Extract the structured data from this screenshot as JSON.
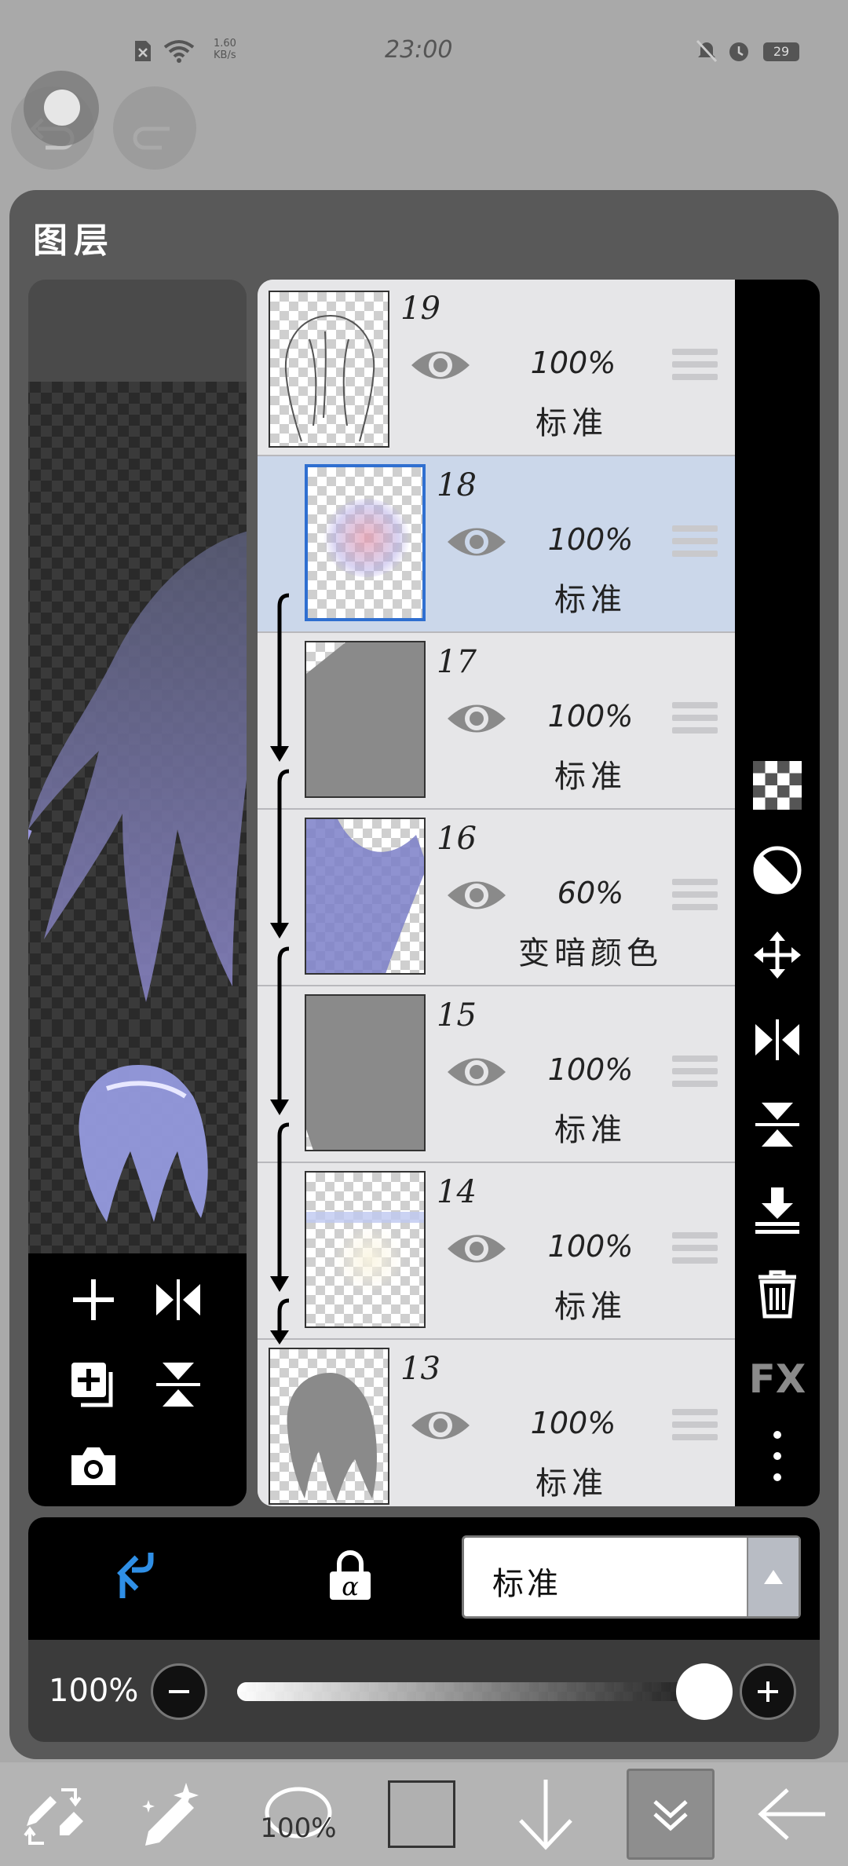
{
  "status_bar": {
    "network_speed": "1.60\nKB/s",
    "time": "23:00",
    "battery": "29"
  },
  "panel": {
    "title": "图层"
  },
  "layers": [
    {
      "number": "19",
      "opacity": "100%",
      "blend_mode": "标准",
      "selected": false
    },
    {
      "number": "18",
      "opacity": "100%",
      "blend_mode": "标准",
      "selected": true
    },
    {
      "number": "17",
      "opacity": "100%",
      "blend_mode": "标准",
      "selected": false
    },
    {
      "number": "16",
      "opacity": "60%",
      "blend_mode": "变暗颜色",
      "selected": false
    },
    {
      "number": "15",
      "opacity": "100%",
      "blend_mode": "标准",
      "selected": false
    },
    {
      "number": "14",
      "opacity": "100%",
      "blend_mode": "标准",
      "selected": false
    },
    {
      "number": "13",
      "opacity": "100%",
      "blend_mode": "标准",
      "selected": false
    }
  ],
  "side_tools": {
    "fx_label": "FX"
  },
  "blend_bar": {
    "selected_blend": "标准"
  },
  "opacity_control": {
    "label": "100%",
    "value": 1.0
  },
  "toolbar": {
    "brush_size_label": "100%"
  },
  "colors": {
    "selected_row": "#cbd7ea",
    "selection_border": "#2f6fd0",
    "clip_arrow_accent": "#2f8fe6"
  }
}
